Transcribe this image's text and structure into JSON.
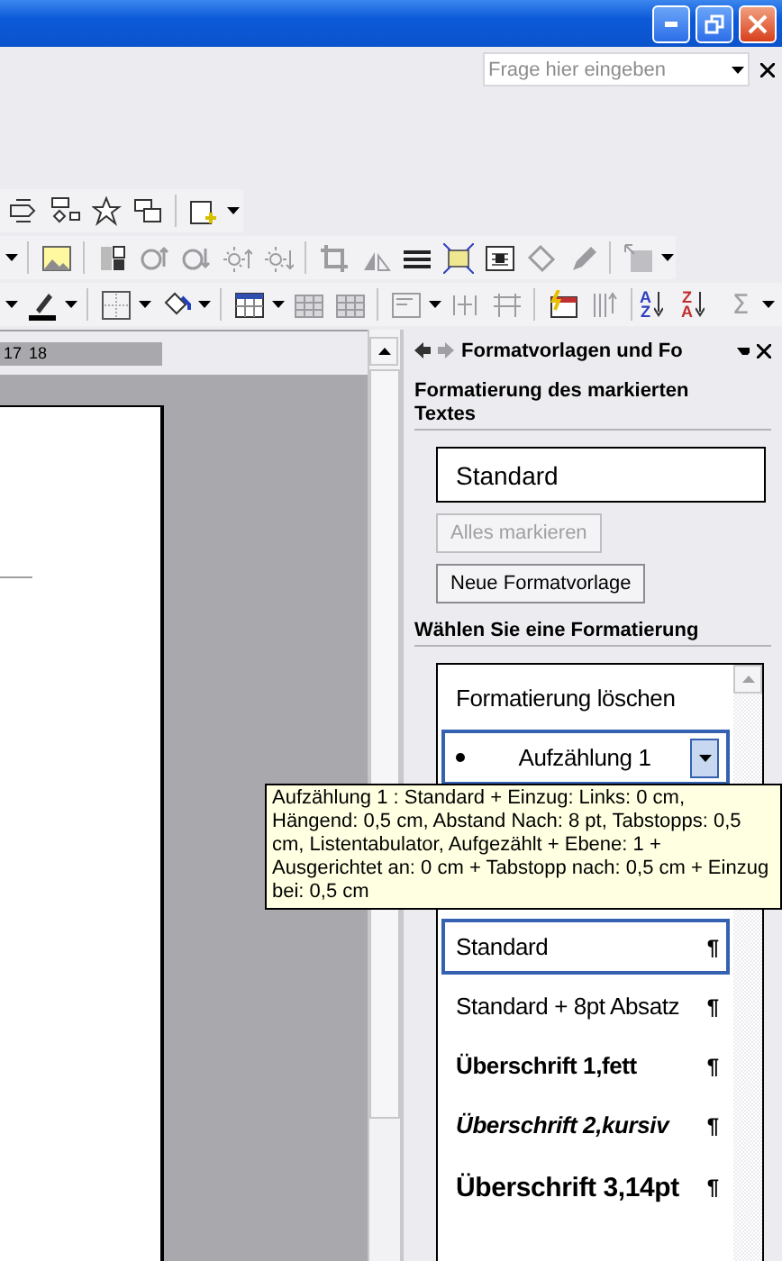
{
  "help_field": {
    "placeholder": "Frage hier eingeben"
  },
  "ruler": {
    "marks": [
      "17",
      "18"
    ]
  },
  "toolbar": {
    "sort_buttons": [
      {
        "top": "A",
        "bottom": "Z"
      },
      {
        "top": "Z",
        "bottom": "A"
      }
    ],
    "sum_symbol": "Σ"
  },
  "task_pane": {
    "title": "Formatvorlagen und Fo",
    "section_1": "Formatierung des markierten Textes",
    "current_style": "Standard",
    "buttons": [
      {
        "label": "Alles markieren",
        "disabled": true
      },
      {
        "label": "Neue Formatvorlage",
        "disabled": false
      }
    ],
    "section_2": "Wählen Sie eine Formatierung",
    "styles": [
      {
        "label": "Formatierung löschen",
        "kind": "clear",
        "selected": false,
        "hovered": false
      },
      {
        "label": "Aufzählung 1",
        "kind": "bullet",
        "selected": true,
        "hovered": false
      },
      {
        "label": "Standard",
        "kind": "normal",
        "mark": "¶",
        "selected": false,
        "hovered": true
      },
      {
        "label": "Standard + 8pt Absatz",
        "kind": "normal",
        "mark": "¶",
        "selected": false,
        "hovered": false
      },
      {
        "label": "Überschrift 1,fett",
        "kind": "heading1",
        "mark": "¶",
        "selected": false,
        "hovered": false
      },
      {
        "label": "Überschrift 2,kursiv",
        "kind": "heading2",
        "mark": "¶",
        "selected": false,
        "hovered": false
      },
      {
        "label": "Überschrift 3,14pt",
        "kind": "heading3",
        "mark": "¶",
        "selected": false,
        "hovered": false
      }
    ]
  },
  "tooltip": {
    "text": "Aufzählung 1 : Standard + Einzug: Links:  0 cm, Hängend:  0,5 cm, Abstand Nach:  8 pt, Tabstopps:  0,5 cm, Listentabulator, Aufgezählt + Ebene: 1 + Ausgerichtet an:  0 cm + Tabstopp nach:  0,5 cm + Einzug bei:  0,5 cm"
  }
}
